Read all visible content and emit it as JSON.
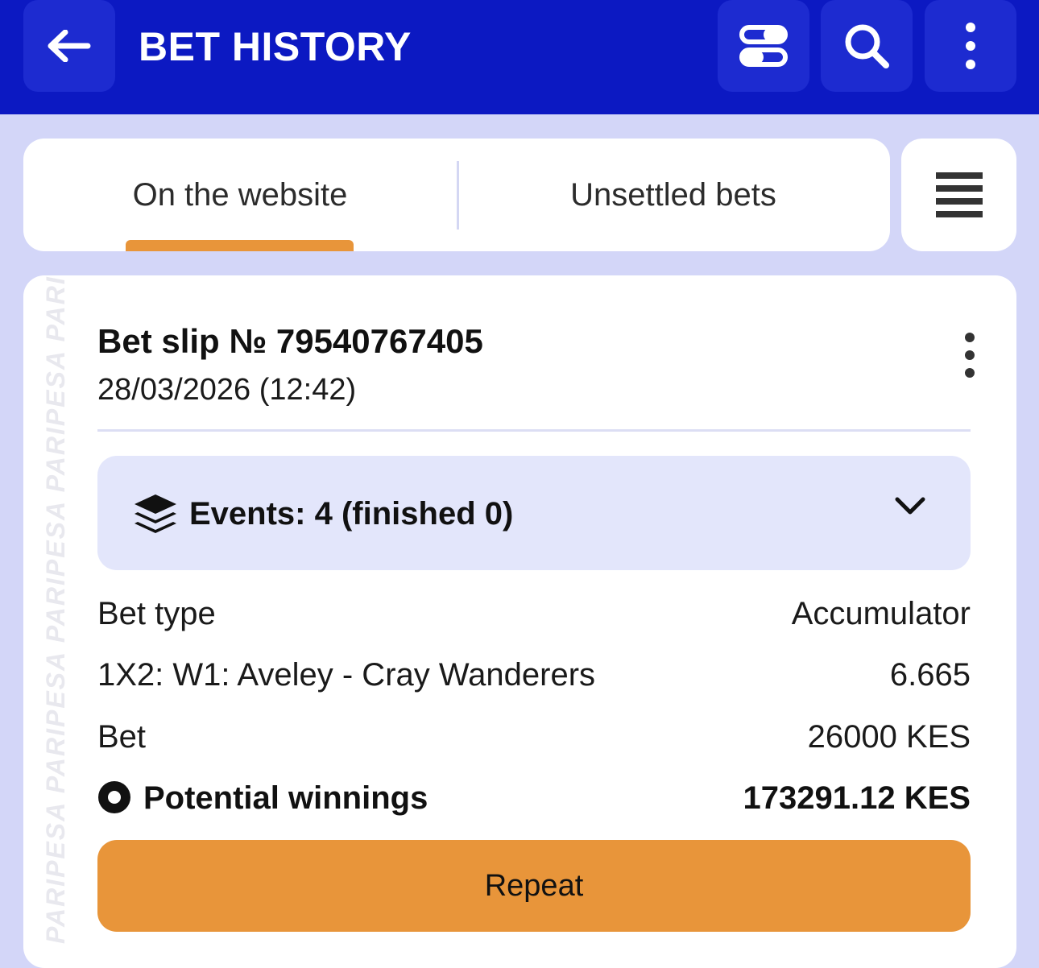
{
  "header": {
    "title": "BET HISTORY",
    "icons": [
      "back-arrow-icon",
      "toggle-view-icon",
      "search-icon",
      "more-vertical-icon"
    ],
    "bg_color": "#0c19c2"
  },
  "tabs": [
    {
      "label": "On the website",
      "active": true
    },
    {
      "label": "Unsettled bets",
      "active": false
    }
  ],
  "accent_color": "#e8953a",
  "bet_slip": {
    "title": "Bet slip № 79540767405",
    "date": "28/03/2026 (12:42)",
    "watermark": "PARIPESA PARIPESA PARIPESA PARIPESA PARIPESA",
    "events_label": "Events: 4 (finished 0)",
    "rows": [
      {
        "label": "Bet type",
        "value": "Accumulator"
      },
      {
        "label": "1X2: W1: Aveley - Cray Wanderers",
        "value": "6.665"
      },
      {
        "label": "Bet",
        "value": "26000 KES"
      }
    ],
    "potential": {
      "label": "Potential winnings",
      "value": "173291.12 KES"
    },
    "repeat_label": "Repeat"
  }
}
